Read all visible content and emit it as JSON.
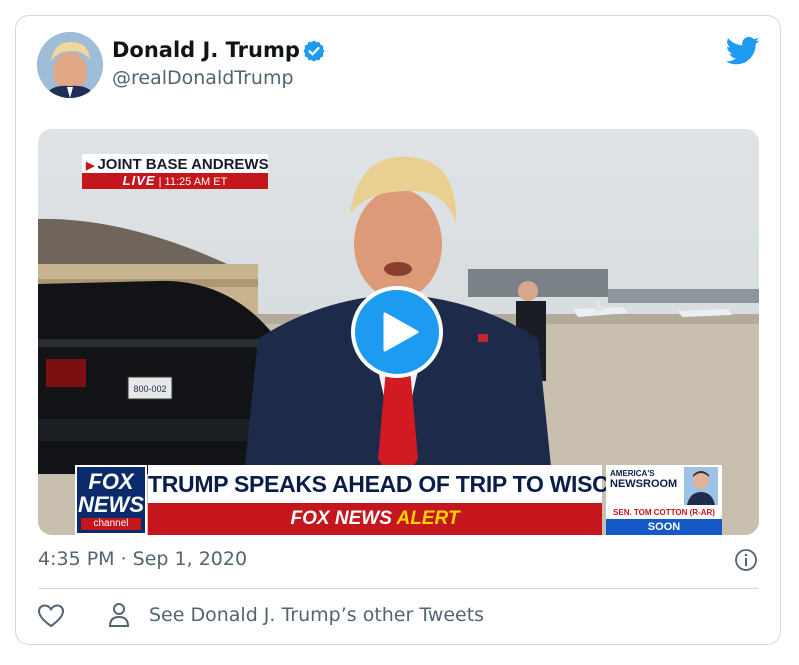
{
  "tweet": {
    "author_name": "Donald J. Trump",
    "handle": "@realDonaldTrump",
    "timestamp": "4:35 PM · Sep 1, 2020",
    "other_tweets_label": "See Donald J. Trump’s other Tweets"
  },
  "video": {
    "location_label": "JOINT BASE ANDREWS",
    "live_label": "LIVE",
    "live_time": "| 11:25 AM ET",
    "network_line1": "FOX",
    "network_line2": "NEWS",
    "network_line3": "channel",
    "headline": "TRUMP SPEAKS AHEAD OF TRIP TO WISCONSIN",
    "alert_part1": "FOX NEWS",
    "alert_part2": "ALERT",
    "promo_show_top": "AMERICA'S",
    "promo_show_bottom": "NEWSROOM",
    "promo_guest": "SEN. TOM COTTON (R-AR)",
    "promo_time": "SOON",
    "license_plate": "800-002"
  },
  "colors": {
    "twitter_blue": "#1d9bf0",
    "fox_red": "#c4161c",
    "fox_navy": "#0a2a6b",
    "secondary_text": "#536471"
  },
  "icons": [
    "verified-badge-icon",
    "twitter-bird-icon",
    "play-icon",
    "info-icon",
    "heart-icon",
    "person-icon"
  ]
}
